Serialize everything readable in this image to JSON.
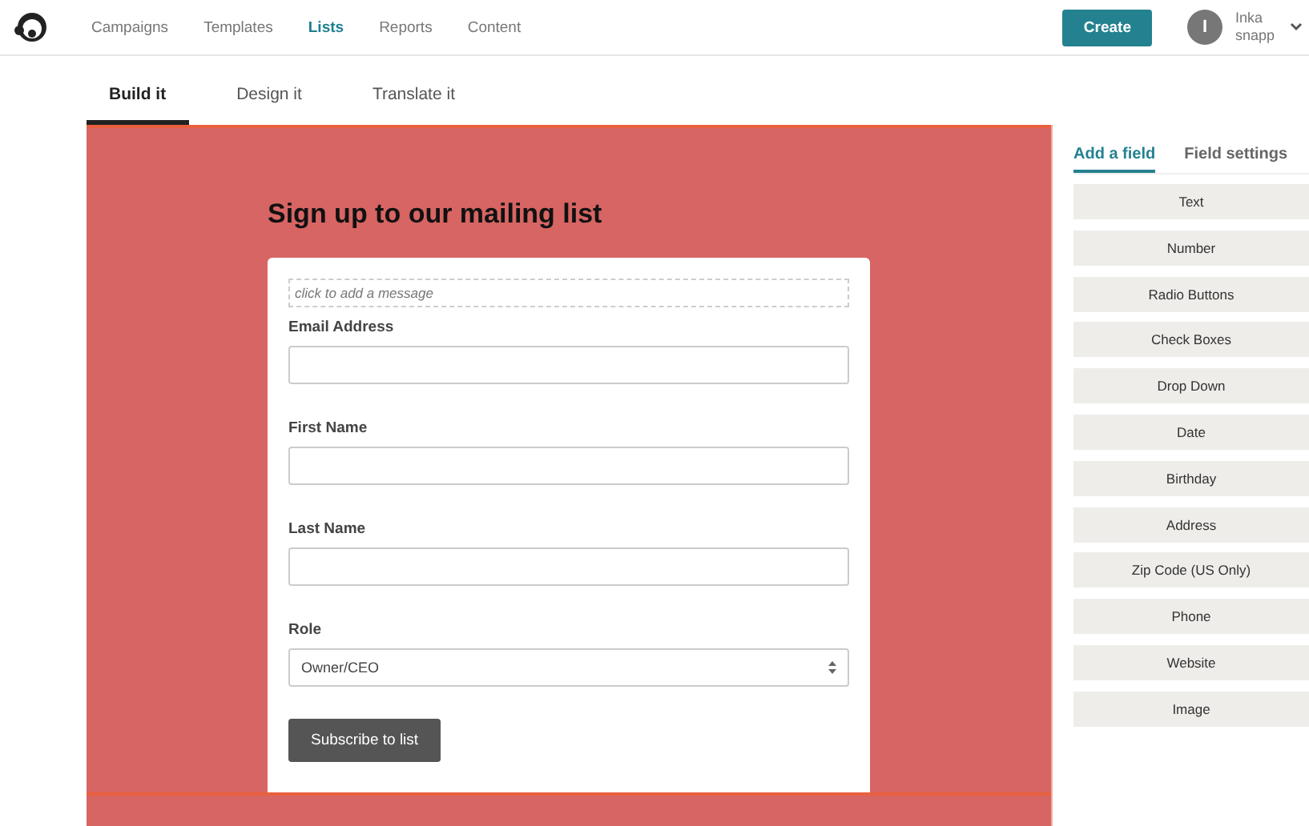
{
  "nav": {
    "items": [
      {
        "label": "Campaigns",
        "selected": false
      },
      {
        "label": "Templates",
        "selected": false
      },
      {
        "label": "Lists",
        "selected": true
      },
      {
        "label": "Reports",
        "selected": false
      },
      {
        "label": "Content",
        "selected": false
      }
    ],
    "create": "Create",
    "avatar": "I",
    "user": "Inka snapp"
  },
  "tabs": [
    {
      "label": "Build it",
      "selected": true
    },
    {
      "label": "Design it",
      "selected": false
    },
    {
      "label": "Translate it",
      "selected": false
    }
  ],
  "form": {
    "title": "Sign up to our mailing list",
    "message_placeholder": "click to add a message",
    "fields": [
      {
        "kind": "text",
        "label": "Email Address"
      },
      {
        "kind": "text",
        "label": "First Name"
      },
      {
        "kind": "text",
        "label": "Last Name"
      },
      {
        "kind": "select",
        "label": "Role",
        "value": "Owner/CEO"
      }
    ],
    "submit": "Subscribe to list"
  },
  "panel": {
    "tabs": [
      {
        "label": "Add a field",
        "selected": true
      },
      {
        "label": "Field settings",
        "selected": false
      }
    ],
    "field_types": [
      "Text",
      "Number",
      "Radio Buttons",
      "Check Boxes",
      "Drop Down",
      "Date",
      "Birthday",
      "Address",
      "Zip Code (US Only)",
      "Phone",
      "Website",
      "Image"
    ]
  }
}
